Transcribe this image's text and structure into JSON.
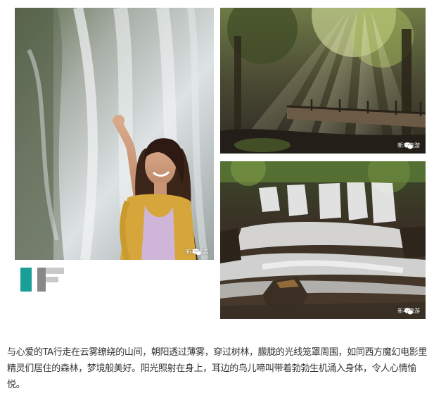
{
  "article": {
    "watermark_text": "新丰旅游",
    "caption": "与心爱的TA行走在云雾缭绕的山间，朝阳透过薄雾，穿过树林，朦胧的光线笼罩周围，如同西方魔幻电影里精灵们居住的森林，梦境般美好。阳光照射在身上，耳边的鸟儿啼叫带着勃勃生机涌入身体，令人心情愉悦。",
    "photos": [
      {
        "subject": "woman-at-waterfall",
        "icon": "wechat-icon"
      },
      {
        "subject": "forest-sunrays-boardwalk",
        "icon": "wechat-icon"
      },
      {
        "subject": "cascading-waterfall",
        "icon": "wechat-icon"
      }
    ],
    "colors": {
      "logo_teal": "#1a9e96",
      "logo_gray": "#888888",
      "logo_light_gray": "#c9c9c9",
      "caption_text": "#333333"
    }
  }
}
